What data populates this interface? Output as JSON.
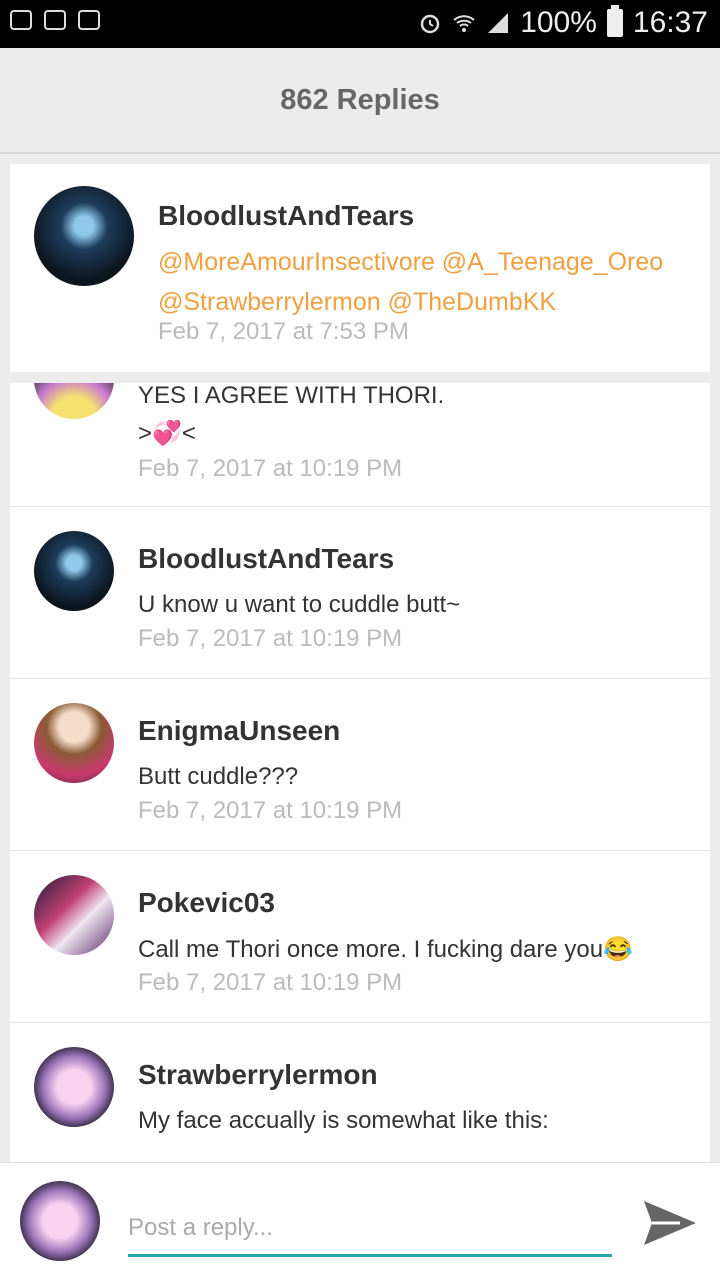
{
  "status_bar": {
    "battery": "100%",
    "time": "16:37"
  },
  "header": {
    "title": "862 Replies"
  },
  "original_post": {
    "author": "BloodlustAndTears",
    "mentions_line1": "@MoreAmourInsectivore @A_Teenage_Oreo",
    "mentions_line2": "@Strawberrylermon @TheDumbKK",
    "timestamp": "Feb 7, 2017 at 7:53 PM"
  },
  "replies": [
    {
      "author": "",
      "message": "YES I AGREE WITH THORI.",
      "message2": ">💞<",
      "timestamp": "Feb 7, 2017 at 10:19 PM"
    },
    {
      "author": "BloodlustAndTears",
      "message": "U know u want to cuddle butt~",
      "timestamp": "Feb 7, 2017 at 10:19 PM"
    },
    {
      "author": "EnigmaUnseen",
      "message": "Butt cuddle???",
      "timestamp": "Feb 7, 2017 at 10:19 PM"
    },
    {
      "author": "Pokevic03",
      "message": "Call me Thori once more. I fucking dare you😂",
      "timestamp": "Feb 7, 2017 at 10:19 PM"
    },
    {
      "author": "Strawberrylermon",
      "message": "My face accually is somewhat like this:",
      "timestamp": ""
    }
  ],
  "composer": {
    "placeholder": "Post a reply..."
  },
  "colors": {
    "mention": "#f0a040",
    "accent": "#25a5a3"
  }
}
